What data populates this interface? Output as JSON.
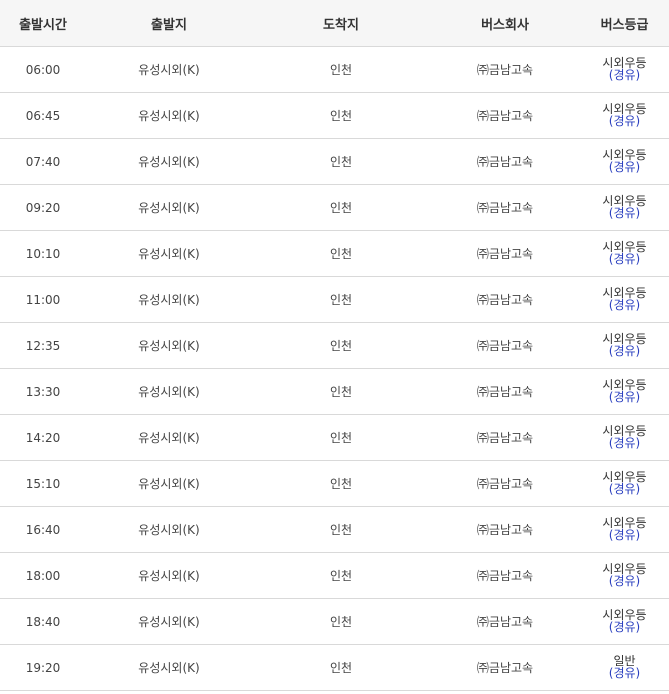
{
  "headers": [
    "출발시간",
    "출발지",
    "도착지",
    "버스회사",
    "버스등급"
  ],
  "rows": [
    {
      "time": "06:00",
      "from": "유성시외(K)",
      "to": "인천",
      "company": "㈜금남고속",
      "grade": "시외우등",
      "sub": "(경유)"
    },
    {
      "time": "06:45",
      "from": "유성시외(K)",
      "to": "인천",
      "company": "㈜금남고속",
      "grade": "시외우등",
      "sub": "(경유)"
    },
    {
      "time": "07:40",
      "from": "유성시외(K)",
      "to": "인천",
      "company": "㈜금남고속",
      "grade": "시외우등",
      "sub": "(경유)"
    },
    {
      "time": "09:20",
      "from": "유성시외(K)",
      "to": "인천",
      "company": "㈜금남고속",
      "grade": "시외우등",
      "sub": "(경유)"
    },
    {
      "time": "10:10",
      "from": "유성시외(K)",
      "to": "인천",
      "company": "㈜금남고속",
      "grade": "시외우등",
      "sub": "(경유)"
    },
    {
      "time": "11:00",
      "from": "유성시외(K)",
      "to": "인천",
      "company": "㈜금남고속",
      "grade": "시외우등",
      "sub": "(경유)"
    },
    {
      "time": "12:35",
      "from": "유성시외(K)",
      "to": "인천",
      "company": "㈜금남고속",
      "grade": "시외우등",
      "sub": "(경유)"
    },
    {
      "time": "13:30",
      "from": "유성시외(K)",
      "to": "인천",
      "company": "㈜금남고속",
      "grade": "시외우등",
      "sub": "(경유)"
    },
    {
      "time": "14:20",
      "from": "유성시외(K)",
      "to": "인천",
      "company": "㈜금남고속",
      "grade": "시외우등",
      "sub": "(경유)"
    },
    {
      "time": "15:10",
      "from": "유성시외(K)",
      "to": "인천",
      "company": "㈜금남고속",
      "grade": "시외우등",
      "sub": "(경유)"
    },
    {
      "time": "16:40",
      "from": "유성시외(K)",
      "to": "인천",
      "company": "㈜금남고속",
      "grade": "시외우등",
      "sub": "(경유)"
    },
    {
      "time": "18:00",
      "from": "유성시외(K)",
      "to": "인천",
      "company": "㈜금남고속",
      "grade": "시외우등",
      "sub": "(경유)"
    },
    {
      "time": "18:40",
      "from": "유성시외(K)",
      "to": "인천",
      "company": "㈜금남고속",
      "grade": "시외우등",
      "sub": "(경유)"
    },
    {
      "time": "19:20",
      "from": "유성시외(K)",
      "to": "인천",
      "company": "㈜금남고속",
      "grade": "일반",
      "sub": "(경유)"
    }
  ]
}
